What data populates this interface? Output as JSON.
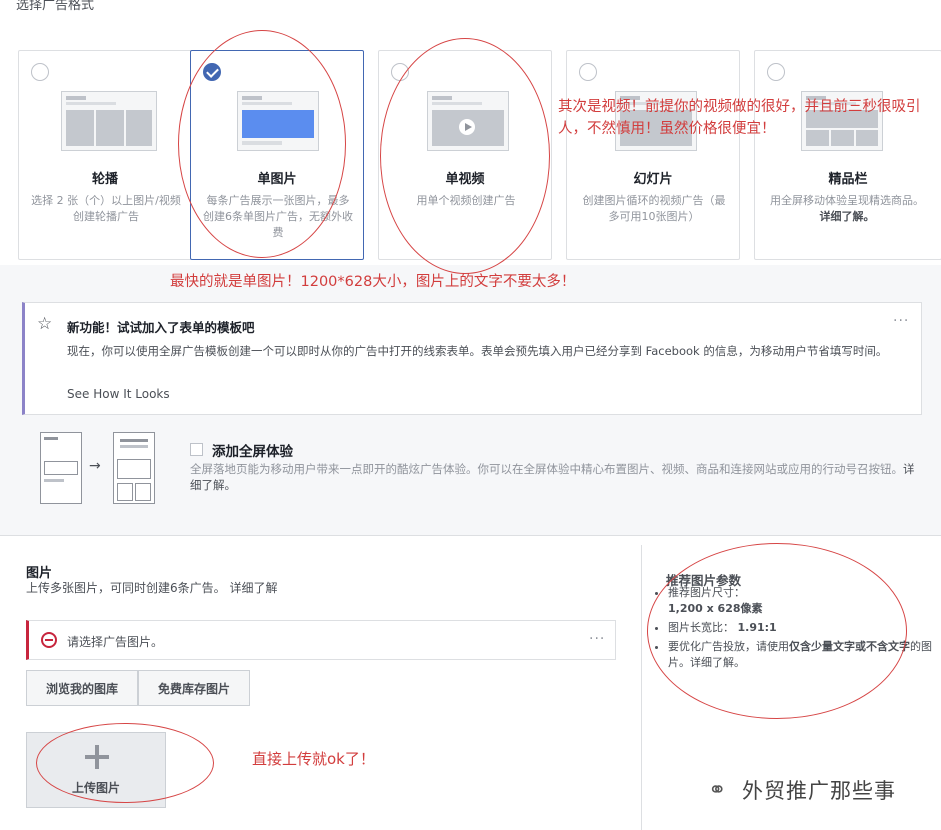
{
  "top": {
    "title": "选择广告格式"
  },
  "formats": [
    {
      "title": "轮播",
      "desc": "选择 2 张（个）以上图片/视频创建轮播广告",
      "selected": false,
      "icon": "carousel-thumbnail"
    },
    {
      "title": "单图片",
      "desc": "每条广告展示一张图片，最多创建6条单图片广告，无额外收费",
      "selected": true,
      "icon": "single-image-thumbnail"
    },
    {
      "title": "单视频",
      "desc": "用单个视频创建广告",
      "selected": false,
      "icon": "single-video-thumbnail"
    },
    {
      "title": "幻灯片",
      "desc": "创建图片循环的视频广告（最多可用10张图片）",
      "selected": false,
      "icon": "slideshow-thumbnail"
    },
    {
      "title": "精品栏",
      "desc": "用全屏移动体验呈现精选商品。",
      "link": "详细了解。",
      "selected": false,
      "icon": "collection-thumbnail"
    }
  ],
  "annotations": {
    "video": "其次是视频！前提你的视频做的很好，并且前三秒很吸引人，不然慎用！虽然价格很便宜！",
    "single_image": "最快的就是单图片！1200*628大小，图片上的文字不要太多！",
    "upload": "直接上传就ok了！"
  },
  "notice": {
    "title": "新功能！试试加入了表单的模板吧",
    "body": "现在，你可以使用全屏广告模板创建一个可以即时从你的广告中打开的线索表单。表单会预先填入用户已经分享到 Facebook 的信息，为移动用户节省填写时间。",
    "link": "See How It Looks",
    "more": "···"
  },
  "fullscreen": {
    "title": "添加全屏体验",
    "body": "全屏落地页能为移动用户带来一点即开的酷炫广告体验。你可以在全屏体验中精心布置图片、视频、商品和连接网站或应用的行动号召按钮。",
    "link": "详细了解。",
    "arrow": "→"
  },
  "images_section": {
    "title": "图片",
    "desc": "上传多张图片，可同时创建6条广告。",
    "desc_link": "详细了解",
    "error": "请选择广告图片。",
    "more": "···",
    "browse_button": "浏览我的图库",
    "stock_button": "免费库存图片",
    "upload_label": "上传图片"
  },
  "recommend": {
    "title": "推荐图片参数",
    "items": [
      {
        "label": "推荐图片尺寸：",
        "value": "1,200 x 628像素"
      },
      {
        "label": "图片长宽比：",
        "value": "1.91:1"
      },
      {
        "label": "要优化广告投放，请使用",
        "value": "仅含少量文字或不含文字",
        "suffix": "的图片。",
        "link": "详细了解。"
      }
    ]
  },
  "watermark": "外贸推广那些事",
  "colors": {
    "accent": "#4267b2",
    "annotation": "#d23d3d",
    "error": "#c7253d",
    "notice_border": "#8c83c8"
  }
}
